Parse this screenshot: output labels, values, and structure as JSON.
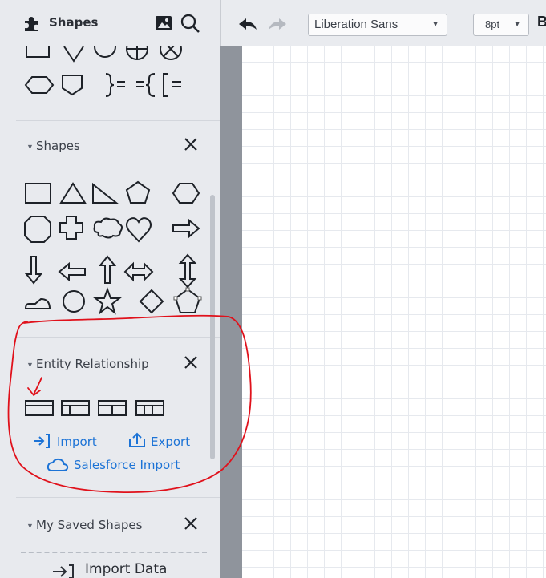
{
  "sidebar": {
    "title": "Shapes",
    "icons": [
      "puzzle-icon",
      "image-icon",
      "search-icon"
    ],
    "sections": {
      "shapes": {
        "title": "Shapes"
      },
      "entity_relationship": {
        "title": "Entity Relationship",
        "links": {
          "import": "Import",
          "export": "Export",
          "salesforce": "Salesforce Import"
        }
      },
      "saved": {
        "title": "My Saved Shapes"
      }
    },
    "import_data": "Import Data"
  },
  "toolbar": {
    "font": "Liberation Sans",
    "font_size": "8pt",
    "bold_label": "B",
    "icons": [
      "undo-icon",
      "redo-icon"
    ]
  },
  "colors": {
    "panel_bg": "#e8eaee",
    "link": "#1c73d6",
    "annotation": "#e0111b",
    "splitter": "#8f949c"
  }
}
